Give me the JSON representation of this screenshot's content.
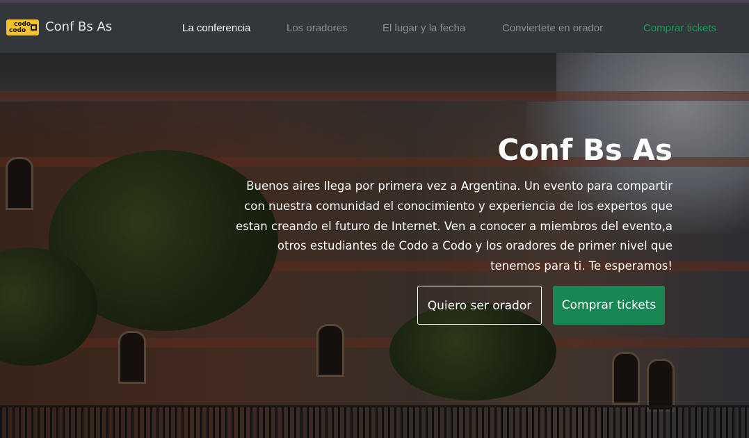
{
  "brand": {
    "logo_line1": "codo",
    "logo_line2": "codo",
    "name": "Conf Bs As"
  },
  "nav": {
    "items": [
      {
        "label": "La conferencia",
        "state": "active"
      },
      {
        "label": "Los oradores",
        "state": "normal"
      },
      {
        "label": "El lugar y la fecha",
        "state": "normal"
      },
      {
        "label": "Conviertete en orador",
        "state": "normal"
      },
      {
        "label": "Comprar tickets",
        "state": "cta"
      }
    ]
  },
  "hero": {
    "title": "Conf Bs As",
    "description": "Buenos aires llega por primera vez a Argentina. Un evento para compartir con nuestra comunidad el conocimiento y experiencia de los expertos que estan creando el futuro de Internet. Ven a conocer a miembros del evento,a otros estudiantes de Codo a Codo y los oradores de primer nivel que tenemos para ti. Te esperamos!",
    "button_speaker": "Quiero ser orador",
    "button_tickets": "Comprar tickets"
  },
  "colors": {
    "navbar_bg": "#33373b",
    "nav_active": "#ffffff",
    "nav_muted": "#8a8f95",
    "nav_cta": "#1f9a55",
    "success_button": "#198754",
    "logo_yellow": "#f2c22e"
  }
}
